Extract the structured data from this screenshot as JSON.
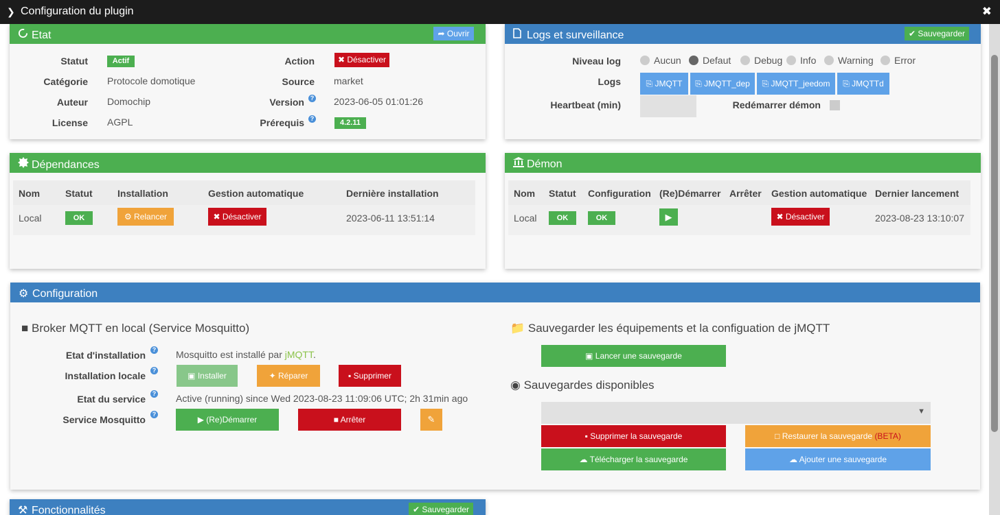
{
  "window": {
    "title": "Configuration du plugin"
  },
  "etat": {
    "title": "Etat",
    "open_label": "Ouvrir",
    "statut_label": "Statut",
    "statut_value": "Actif",
    "categorie_label": "Catégorie",
    "categorie_value": "Protocole domotique",
    "auteur_label": "Auteur",
    "auteur_value": "Domochip",
    "license_label": "License",
    "license_value": "AGPL",
    "action_label": "Action",
    "action_button": "Désactiver",
    "source_label": "Source",
    "source_value": "market",
    "version_label": "Version",
    "version_value": "2023-06-05 01:01:26",
    "prerequis_label": "Prérequis",
    "prerequis_value": "4.2.11"
  },
  "logs": {
    "title": "Logs et surveillance",
    "save_label": "Sauvegarder",
    "niveau_label": "Niveau log",
    "levels": [
      "Aucun",
      "Defaut",
      "Debug",
      "Info",
      "Warning",
      "Error"
    ],
    "selected_level": "Defaut",
    "logs_label": "Logs",
    "log_buttons": [
      "JMQTT",
      "JMQTT_dep",
      "JMQTT_jeedom",
      "JMQTTd"
    ],
    "heartbeat_label": "Heartbeat (min)",
    "heartbeat_value": "",
    "restart_label": "Redémarrer démon"
  },
  "deps": {
    "title": "Dépendances",
    "headers": [
      "Nom",
      "Statut",
      "Installation",
      "Gestion automatique",
      "Dernière installation"
    ],
    "row": {
      "nom": "Local",
      "statut": "OK",
      "installation": "Relancer",
      "gestion": "Désactiver",
      "derniere": "2023-06-11 13:51:14"
    }
  },
  "daemon": {
    "title": "Démon",
    "headers": [
      "Nom",
      "Statut",
      "Configuration",
      "(Re)Démarrer",
      "Arrêter",
      "Gestion automatique",
      "Dernier lancement"
    ],
    "row": {
      "nom": "Local",
      "statut": "OK",
      "configuration": "OK",
      "gestion": "Désactiver",
      "dernier": "2023-08-23 13:10:07"
    }
  },
  "config": {
    "title": "Configuration",
    "broker_title": "Broker MQTT en local (Service Mosquitto)",
    "etat_install_label": "Etat d'installation",
    "etat_install_value": "Mosquitto est installé par ",
    "etat_install_link": "jMQTT",
    "etat_install_suffix": ".",
    "install_locale_label": "Installation locale",
    "installer_label": "Installer",
    "reparer_label": "Réparer",
    "supprimer_label": "Supprimer",
    "etat_service_label": "Etat du service",
    "etat_service_value": "Active (running) since Wed 2023-08-23 11:09:06 UTC; 2h 31min ago",
    "service_label": "Service Mosquitto",
    "redemarrer_label": "(Re)Démarrer",
    "arreter_label": "Arrêter",
    "backup_title": "Sauvegarder les équipements et la configuation de jMQTT",
    "lancer_label": "Lancer une sauvegarde",
    "available_title": "Sauvegardes disponibles",
    "selected_backup": "",
    "supprimer_sauv_label": "Supprimer la sauvegarde",
    "restaurer_label": "Restaurer la sauvegarde ",
    "restaurer_beta": "(BETA)",
    "telecharger_label": "Télécharger la sauvegarde",
    "ajouter_label": "Ajouter une sauvegarde"
  },
  "fonct": {
    "title": "Fonctionnalités",
    "save_label": "Sauvegarder"
  },
  "colors": {
    "green": "#4caf50",
    "blue": "#3d80c0",
    "red": "#c9101c",
    "orange": "#f0a33a",
    "lightblue": "#5fa2e8",
    "link_green": "#8bc34a"
  }
}
